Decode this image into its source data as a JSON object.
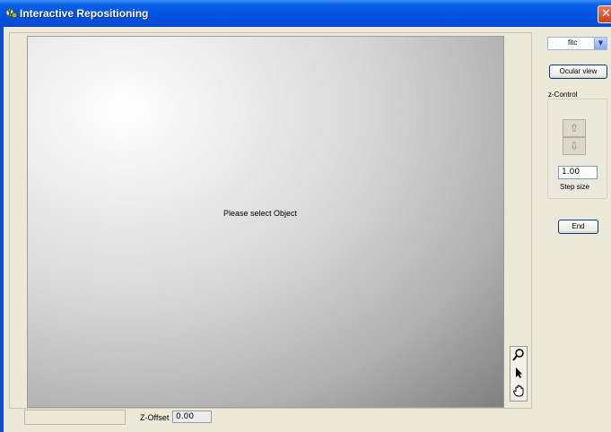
{
  "window": {
    "title": "Interactive Repositioning",
    "close_icon": "close-icon",
    "app_icon": "app-icon"
  },
  "viewport": {
    "message": "Please select Object"
  },
  "toolbox": {
    "tools": [
      {
        "name": "zoom-tool",
        "icon": "magnifier-icon",
        "glyph": "⚲"
      },
      {
        "name": "select-tool",
        "icon": "pointer-icon",
        "glyph": "➤"
      },
      {
        "name": "pan-tool",
        "icon": "hand-icon",
        "glyph": "✋"
      }
    ]
  },
  "status": {
    "zoffset_label": "Z-Offset",
    "zoffset_value": "0.00"
  },
  "right_panel": {
    "filter_value": "fitc",
    "ocular_label": "Ocular view",
    "zcontrol_label": "z-Control",
    "up_glyph": "⇧",
    "down_glyph": "⇩",
    "step_value": "1.00",
    "step_label": "Step size",
    "end_label": "End"
  },
  "colors": {
    "titlebar": "#0054e3",
    "window_bg": "#ece9d8",
    "close_red": "#c9401f"
  }
}
